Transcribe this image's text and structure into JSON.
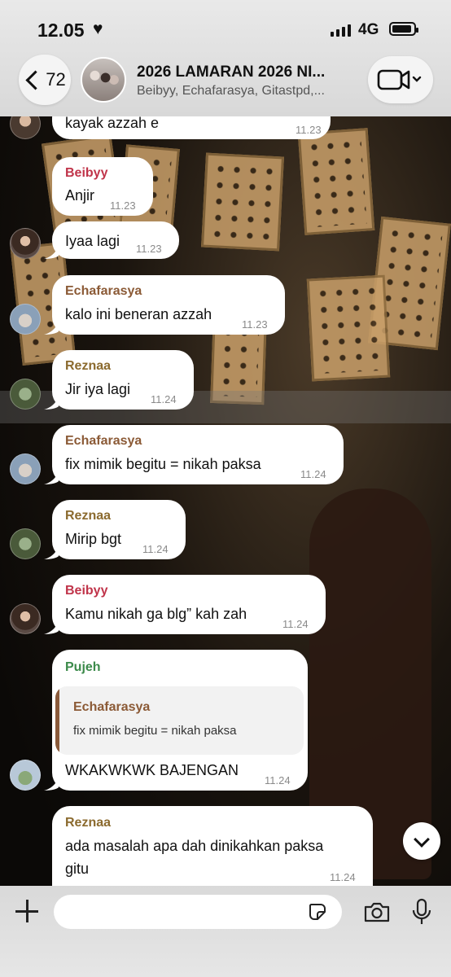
{
  "status_bar": {
    "time": "12.05",
    "heart": "♥",
    "network": "4G"
  },
  "header": {
    "back_count": "72",
    "title": "2026 LAMARAN 2026 NI...",
    "subtitle": "Beibyy, Echafarasya, Gitastpd,..."
  },
  "colors": {
    "beibyy": "#c0344a",
    "echafarasya": "#8b5a36",
    "reznaa": "#8b6a2e",
    "pujeh": "#3b8a4a"
  },
  "messages": [
    {
      "sender": "",
      "text": "kayak azzah e",
      "time": "11.23"
    },
    {
      "sender": "Beibyy",
      "text": "Anjir",
      "time": "11.23"
    },
    {
      "sender": "",
      "text": "Iyaa lagi",
      "time": "11.23"
    },
    {
      "sender": "Echafarasya",
      "text": "kalo ini beneran azzah",
      "time": "11.23"
    },
    {
      "sender": "Reznaa",
      "text": "Jir iya lagi",
      "time": "11.24"
    },
    {
      "sender": "Echafarasya",
      "text": "fix mimik begitu = nikah paksa",
      "time": "11.24"
    },
    {
      "sender": "Reznaa",
      "text": "Mirip bgt",
      "time": "11.24"
    },
    {
      "sender": "Beibyy",
      "text": "Kamu nikah ga blg” kah zah",
      "time": "11.24"
    },
    {
      "sender": "Pujeh",
      "quote_sender": "Echafarasya",
      "quote_text": "fix mimik begitu = nikah paksa",
      "text": "WKAKWKWK BAJENGAN",
      "time": "11.24"
    },
    {
      "sender": "Reznaa",
      "text_line1": "ada masalah apa dah dinikahkan paksa",
      "text_line2": "gitu",
      "time": "11.24"
    }
  ],
  "input": {
    "placeholder": ""
  }
}
